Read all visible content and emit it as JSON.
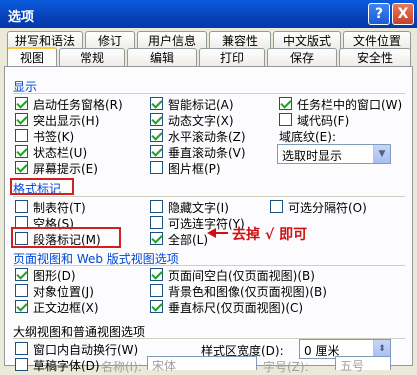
{
  "window": {
    "title": "选项",
    "help_btn": "?",
    "close_btn": "X"
  },
  "tabs_row1": [
    "拼写和语法",
    "修订",
    "用户信息",
    "兼容性",
    "中文版式",
    "文件位置"
  ],
  "tabs_row2": [
    "视图",
    "常规",
    "编辑",
    "打印",
    "保存",
    "安全性"
  ],
  "active_tab": "视图",
  "sections": {
    "display": "显示",
    "format_marks": "格式标记",
    "page_web_view": "页面视图和 Web 版式视图选项",
    "outline_normal": "大纲视图和普通视图选项"
  },
  "display_options": [
    {
      "label": "启动任务窗格(R)",
      "checked": true
    },
    {
      "label": "智能标记(A)",
      "checked": true
    },
    {
      "label": "任务栏中的窗口(W)",
      "checked": true
    },
    {
      "label": "突出显示(H)",
      "checked": true
    },
    {
      "label": "动态文字(X)",
      "checked": true
    },
    {
      "label": "域代码(F)",
      "checked": false
    },
    {
      "label": "书签(K)",
      "checked": false
    },
    {
      "label": "水平滚动条(Z)",
      "checked": true
    },
    {
      "label": "状态栏(U)",
      "checked": true
    },
    {
      "label": "垂直滚动条(V)",
      "checked": true
    },
    {
      "label": "屏幕提示(E)",
      "checked": true
    },
    {
      "label": "图片框(P)",
      "checked": false
    }
  ],
  "field_shading": {
    "label": "域底纹(E):",
    "value": "选取时显示"
  },
  "format_mark_options": [
    {
      "label": "制表符(T)",
      "checked": false
    },
    {
      "label": "隐藏文字(I)",
      "checked": false
    },
    {
      "label": "可选分隔符(O)",
      "checked": false
    },
    {
      "label": "空格(S)",
      "checked": false
    },
    {
      "label": "可选连字符(Y)",
      "checked": false
    },
    {
      "label": "段落标记(M)",
      "checked": false
    },
    {
      "label": "全部(L)",
      "checked": true
    }
  ],
  "annotation": {
    "text": "去掉 √ 即可"
  },
  "page_view_options": [
    {
      "label": "图形(D)",
      "checked": true
    },
    {
      "label": "页面间空白(仅页面视图)(B)",
      "checked": true
    },
    {
      "label": "对象位置(J)",
      "checked": false
    },
    {
      "label": "背景色和图像(仅页面视图)(B)",
      "checked": false
    },
    {
      "label": "正文边框(X)",
      "checked": true
    },
    {
      "label": "垂直标尺(仅页面视图)(C)",
      "checked": true
    }
  ],
  "outline_options": [
    {
      "label": "窗口内自动换行(W)",
      "checked": false
    },
    {
      "label": "草稿字体(D)",
      "checked": false
    }
  ],
  "style_area": {
    "label": "样式区宽度(D):",
    "value": "0 厘米"
  },
  "draft_font": {
    "name_label": "名称(I):",
    "name_value": "宋体",
    "size_label": "字号(Z):",
    "size_value": "五号"
  }
}
